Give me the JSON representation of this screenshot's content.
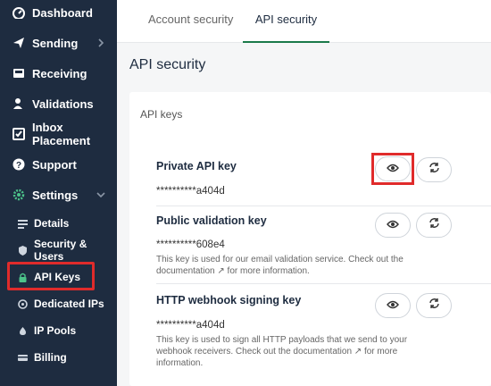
{
  "sidebar": {
    "items": [
      {
        "label": "Dashboard",
        "icon": "dashboard-icon"
      },
      {
        "label": "Sending",
        "icon": "send-icon",
        "chevron": "chevron-right-icon"
      },
      {
        "label": "Receiving",
        "icon": "inbox-icon"
      },
      {
        "label": "Validations",
        "icon": "user-check-icon"
      },
      {
        "label": "Inbox Placement",
        "icon": "checkbox-icon"
      },
      {
        "label": "Support",
        "icon": "help-icon"
      },
      {
        "label": "Settings",
        "icon": "gear-icon",
        "chevron": "chevron-down-icon"
      }
    ],
    "sub_items": [
      {
        "label": "Details",
        "icon": "list-icon"
      },
      {
        "label": "Security & Users",
        "icon": "shield-icon"
      },
      {
        "label": "API Keys",
        "icon": "lock-icon"
      },
      {
        "label": "Dedicated IPs",
        "icon": "ip-icon"
      },
      {
        "label": "IP Pools",
        "icon": "pool-icon"
      },
      {
        "label": "Billing",
        "icon": "billing-icon"
      }
    ]
  },
  "tabs": [
    {
      "label": "Account security"
    },
    {
      "label": "API security"
    }
  ],
  "page_title": "API security",
  "card": {
    "title": "API keys",
    "keys": [
      {
        "label": "Private API key",
        "value": "**********a404d",
        "description": ""
      },
      {
        "label": "Public validation key",
        "value": "**********608e4",
        "description": "This key is used for our email validation service. Check out the documentation ↗ for more information."
      },
      {
        "label": "HTTP webhook signing key",
        "value": "**********a404d",
        "description": "This key is used to sign all HTTP payloads that we send to your webhook receivers. Check out the documentation ↗ for more information."
      }
    ]
  },
  "colors": {
    "sidebar_bg": "#1e2c40",
    "active_tab": "#1b7a4a",
    "highlight": "#e02b2b"
  }
}
